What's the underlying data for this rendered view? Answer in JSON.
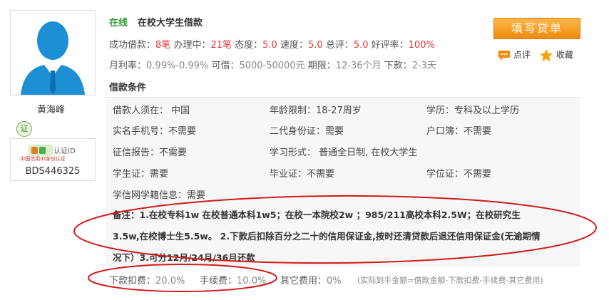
{
  "profile": {
    "name": "黄海峰",
    "cert_icon_text": "证",
    "id_box": {
      "logo_text": "中国信用ID身份认证",
      "label": "认证ID",
      "number": "BDS446325"
    }
  },
  "header": {
    "status": "在线",
    "title": "在校大学生借款"
  },
  "stats_row": [
    {
      "label": "成功借款：",
      "value": "8笔"
    },
    {
      "label": "办理中：",
      "value": "21笔"
    },
    {
      "label": "态度：",
      "value": "5.0"
    },
    {
      "label": "速度：",
      "value": "5.0"
    },
    {
      "label": "总评：",
      "value": "5.0"
    },
    {
      "label": "好评率：",
      "value": "100%"
    }
  ],
  "info_row": [
    {
      "label": "月利率：",
      "value": "0.99%-0.99%"
    },
    {
      "label": "可借：",
      "value": "5000-50000元"
    },
    {
      "label": "期限：",
      "value": "12-36个月"
    },
    {
      "label": "下款：",
      "value": "2-3天"
    }
  ],
  "actions": {
    "apply_button": "填写贷单",
    "comment": "点评",
    "favorite": "收藏"
  },
  "conditions": {
    "title": "借款条件",
    "items": [
      "借款人须在： 中国",
      "年龄限制：18-27周岁",
      "学历：专科及以上学历",
      "实名手机号：不需要",
      "二代身份证：需要",
      "户口簿：不需要",
      "征信报告：不需要",
      "学习形式： 普通全日制, 在校大学生",
      "学生证：需要",
      "毕业证：不需要",
      "学位证：不需要",
      "学信网学籍信息：需要"
    ],
    "note_lines": [
      "备注：1.在校专科1w 在校普通本科1w5；在校一本院校2w ；985/211高校本科2.5W；在校研究生",
      "3.5w,在校博士生5.5w。 2.下款后扣除百分之二十的信用保证金,按时还清贷款后退还信用保证金(无逾期情",
      "况下）3.可分12月/24月/36月还款"
    ]
  },
  "fees": {
    "deduct_label": "下款扣费：",
    "deduct_value": "20.0%",
    "handling_label": "手续费：",
    "handling_value": "10.0%",
    "other_label": "其它费用：",
    "other_value": "0%",
    "formula_note": "(实际到手金额=借款金额-下款扣费-手续费-其它费用)"
  },
  "colors": {
    "online_green": "#2e9b2e",
    "highlight_red": "#e03434",
    "button_orange": "#f39a1e",
    "annotation_red": "#d11a1a"
  }
}
